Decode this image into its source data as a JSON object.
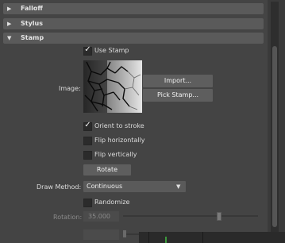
{
  "sections": {
    "falloff": {
      "label": "Falloff",
      "expanded": false
    },
    "stylus": {
      "label": "Stylus",
      "expanded": false
    },
    "stamp": {
      "label": "Stamp",
      "expanded": true
    }
  },
  "stamp": {
    "use_stamp": {
      "label": "Use Stamp",
      "checked": true
    },
    "image_label": "Image:",
    "import_button": "Import...",
    "pick_stamp_button": "Pick Stamp...",
    "orient_to_stroke": {
      "label": "Orient to stroke",
      "checked": true
    },
    "flip_horizontally": {
      "label": "Flip horizontally",
      "checked": false
    },
    "flip_vertically": {
      "label": "Flip vertically",
      "checked": false
    },
    "rotate_button": "Rotate",
    "draw_method": {
      "label": "Draw Method:",
      "value": "Continuous"
    },
    "randomize": {
      "label": "Randomize",
      "checked": false
    },
    "rotation": {
      "label": "Rotation:",
      "value": "35.000",
      "slider_fraction": 0.72
    }
  },
  "icons": {
    "collapsed_arrow": "triangle-right",
    "expanded_arrow": "triangle-down",
    "check": "checkmark",
    "dropdown": "triangle-down"
  },
  "colors": {
    "panel_bg": "#444444",
    "header_bg": "#5a5a5a",
    "button_bg": "#5e5e5e",
    "field_bg": "#2b2b2b",
    "disabled_text": "#8a8a8a"
  }
}
